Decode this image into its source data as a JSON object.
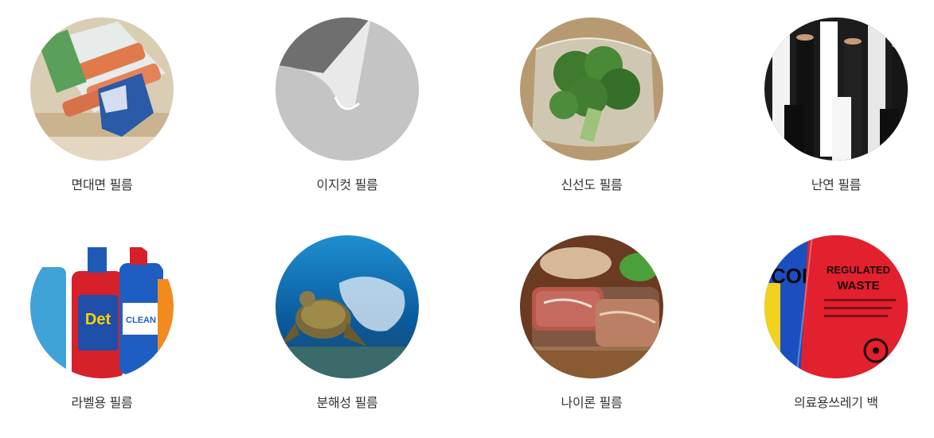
{
  "products": [
    {
      "label": "면대면 필름",
      "image": "crab-stick-package-photo"
    },
    {
      "label": "이지컷 필름",
      "image": "peeling-film-photo"
    },
    {
      "label": "신선도 필름",
      "image": "broccoli-bag-photo"
    },
    {
      "label": "난연 필름",
      "image": "film-rolls-photo"
    },
    {
      "label": "라벨용 필름",
      "image": "detergent-bottles-photo"
    },
    {
      "label": "분해성 필름",
      "image": "sea-turtle-plastic-photo"
    },
    {
      "label": "나이론 필름",
      "image": "vacuum-packed-meat-photo"
    },
    {
      "label": "의료용쓰레기 백",
      "image": "medical-waste-bag-photo"
    }
  ],
  "image_text": {
    "detergent_brand_1": "Det",
    "detergent_brand_2": "CLEAN",
    "waste_bag_line_1": "REGULATED",
    "waste_bag_line_2": "WASTE",
    "waste_bag_side": "CON"
  },
  "colors": {
    "label_text": "#333333",
    "background": "#ffffff"
  }
}
